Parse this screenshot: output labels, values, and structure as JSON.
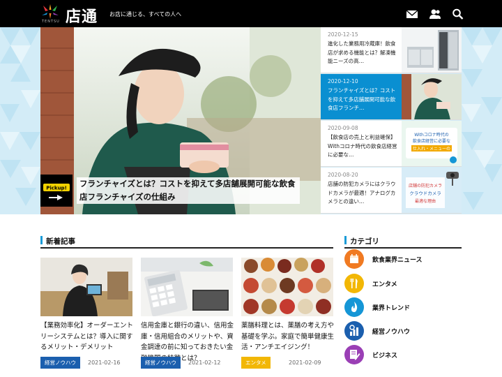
{
  "header": {
    "logo_text": "店通",
    "logo_sub": "TENTSU",
    "tagline": "お店に通じる、すべての人へ",
    "icons": [
      "mail-icon",
      "user-icon",
      "search-icon"
    ]
  },
  "hero": {
    "pickup_label": "Pickup!",
    "pickup_title": "フランチャイズとは？コストを抑えて多店舗展開可能な飲食店フランチャイズの仕組み",
    "side_items": [
      {
        "date": "2020-12-15",
        "text": "進化した業務用冷蔵庫！飲食店が求める機能とは？解凍機能ニーズの高…"
      },
      {
        "date": "2020-12-10",
        "text": "フランチャイズとは？コストを抑えて多店舗展開可能な飲食店フランチ…"
      },
      {
        "date": "2020-09-08",
        "text": "【飲食店の売上と利益確保】Withコロナ時代の飲食店経営に必要な…"
      },
      {
        "date": "2020-08-20",
        "text": "店舗の防犯カメラにはクラウドカメラが最適！アナログカメラとの違い…"
      }
    ],
    "thumb_texts": {
      "covid_line1": "Withコロナ時代の",
      "covid_line2": "飲食店経営に必要な",
      "covid_line3": "仕入れ・メニューの",
      "camera_line1": "店舗の防犯カメラ",
      "camera_line2": "クラウドカメラ",
      "camera_line3": "最適な理由"
    }
  },
  "news": {
    "title": "新着記事",
    "cards": [
      {
        "title": "【業務効率化】オーダーエントリーシステムとは？導入に関するメリット・デメリット",
        "tag": "経営ノウハウ",
        "tag_color": "#1b5fae",
        "date": "2021-02-16"
      },
      {
        "title": "信用金庫と銀行の違い、信用金庫・信用組合のメリットや、資金調達の前に知っておきたい金融機関の特徴とは？",
        "tag": "経営ノウハウ",
        "tag_color": "#1b5fae",
        "date": "2021-02-12"
      },
      {
        "title": "薬膳料理とは、薬膳の考え方や基礎を学ぶ。家庭で簡単健康生活・アンチエイジング！",
        "tag": "エンタメ",
        "tag_color": "#f2b705",
        "date": "2021-02-09"
      }
    ]
  },
  "categories": {
    "title": "カテゴリ",
    "items": [
      {
        "label": "飲食業界ニュース",
        "color": "#f07a22",
        "icon": "calendar-icon"
      },
      {
        "label": "エンタメ",
        "color": "#f2b705",
        "icon": "cutlery-icon"
      },
      {
        "label": "業界トレンド",
        "color": "#1596d6",
        "icon": "flame-icon"
      },
      {
        "label": "経営ノウハウ",
        "color": "#1b5fae",
        "icon": "chart-search-icon"
      },
      {
        "label": "ビジネス",
        "color": "#9a3fb5",
        "icon": "document-pen-icon"
      }
    ]
  }
}
